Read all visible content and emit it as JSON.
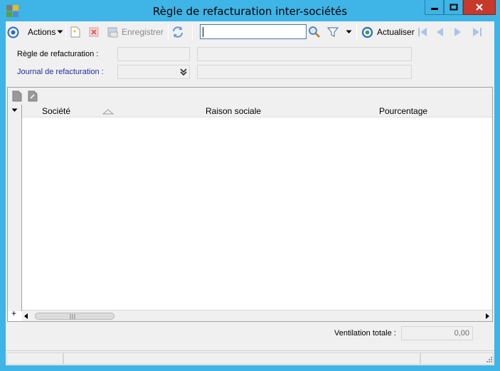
{
  "window": {
    "title": "Règle de refacturation inter-sociétés"
  },
  "toolbar": {
    "actions_label": "Actions",
    "save_label": "Enregistrer",
    "search_value": "",
    "refresh_label": "Actualiser"
  },
  "form": {
    "rule_label": "Règle de refacturation :",
    "rule_code": "",
    "rule_description": "",
    "journal_label": "Journal de refacturation :",
    "journal_code": "",
    "journal_description": ""
  },
  "grid": {
    "columns": [
      "Société",
      "Raison sociale",
      "Pourcentage"
    ],
    "rows": [],
    "add_row_symbol": "+"
  },
  "footer": {
    "total_label": "Ventilation totale :",
    "total_value": "0,00"
  },
  "colors": {
    "window_frame": "#3fb4e6",
    "close_button": "#c7392b",
    "link_label": "#1f2f9e",
    "panel_background": "#f0f0f0"
  }
}
